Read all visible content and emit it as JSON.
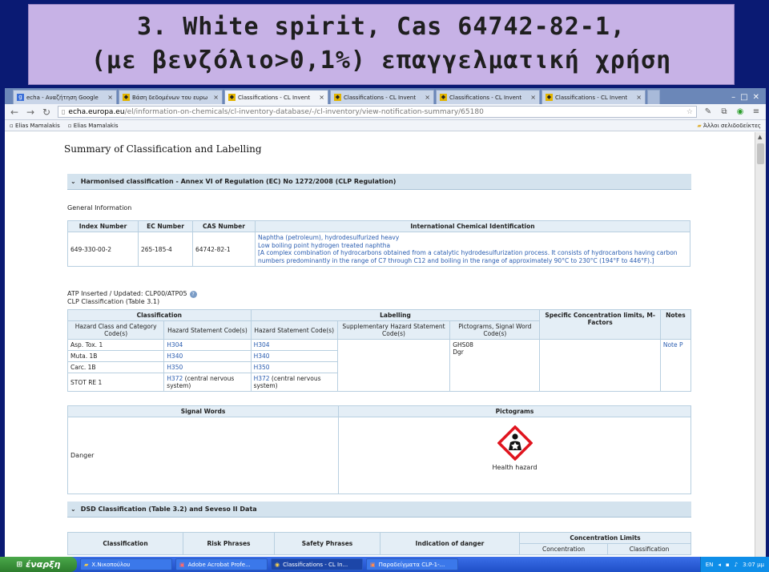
{
  "banner": {
    "line1": "3. White spirit, Cas 64742-82-1,",
    "line2": "(με βενζόλιο>0,1%) επαγγελματική χρήση"
  },
  "browser": {
    "tabs": [
      {
        "label": "echa - Αναζήτηση Google",
        "icon": "google-icon"
      },
      {
        "label": "Βάση δεδομένων του ευρω",
        "icon": "echa-icon"
      },
      {
        "label": "Classifications - CL Invent",
        "icon": "echa-icon",
        "active": true
      },
      {
        "label": "Classifications - CL Invent",
        "icon": "echa-icon"
      },
      {
        "label": "Classifications - CL Invent",
        "icon": "echa-icon"
      },
      {
        "label": "Classifications - CL Invent",
        "icon": "echa-icon"
      }
    ],
    "url_host": "echa.europa.eu",
    "url_path": "/el/information-on-chemicals/cl-inventory-database/-/cl-inventory/view-notification-summary/65180",
    "bookmarks": [
      "Elias Mamalakis",
      "Elias Mamalakis"
    ],
    "other_bookmarks": "Άλλοι σελιδοδείκτες"
  },
  "page": {
    "title": "Summary of Classification and Labelling",
    "harmonised_header": "Harmonised classification - Annex VI of Regulation (EC) No 1272/2008 (CLP Regulation)",
    "general_info": "General Information",
    "ident_headers": [
      "Index Number",
      "EC Number",
      "CAS Number",
      "International Chemical Identification"
    ],
    "ident_row": {
      "index": "649-330-00-2",
      "ec": "265-185-4",
      "cas": "64742-82-1",
      "name_lines": [
        "Naphtha (petroleum), hydrodesulfurized heavy",
        "Low boiling point hydrogen treated naphtha",
        "[A complex combination of hydrocarbons obtained from a catalytic hydrodesulfurization process. It consists of hydrocarbons having carbon numbers predominantly in the range of C7 through C12 and boiling in the range of approximately 90°C to 230°C (194°F to 446°F).]"
      ]
    },
    "atp": "ATP Inserted / Updated: CLP00/ATP05",
    "clp_table": "CLP Classification (Table 3.1)",
    "class_headers": {
      "classification": "Classification",
      "labelling": "Labelling",
      "scl": "Specific Concentration limits, M-Factors",
      "notes": "Notes",
      "hazard_class": "Hazard Class and Category Code(s)",
      "hazard_stmt": "Hazard Statement Code(s)",
      "label_stmt": "Hazard Statement Code(s)",
      "supp_stmt": "Supplementary Hazard Statement Code(s)",
      "pictograms": "Pictograms, Signal Word Code(s)"
    },
    "class_rows": [
      {
        "cls": "Asp. Tox. 1",
        "h": "H304",
        "lh": "H304"
      },
      {
        "cls": "Muta. 1B",
        "h": "H340",
        "lh": "H340"
      },
      {
        "cls": "Carc. 1B",
        "h": "H350",
        "lh": "H350"
      },
      {
        "cls": "STOT RE 1",
        "h": "H372",
        "h_note": " (central nervous system)",
        "lh": "H372",
        "lh_note": " (central nervous system)"
      }
    ],
    "pictogram_codes": [
      "GHS08",
      "Dgr"
    ],
    "notes_link": "Note P",
    "signal_header": "Signal Words",
    "pictograms_header": "Pictograms",
    "signal_word": "Danger",
    "pictogram_caption": "Health hazard",
    "dsd_header": "DSD Classification (Table 3.2) and Seveso II Data",
    "dsd_headers": {
      "classification": "Classification",
      "risk": "Risk Phrases",
      "safety": "Safety Phrases",
      "indication": "Indication of danger",
      "conc_limits": "Concentration Limits",
      "concentration": "Concentration",
      "conc_class": "Classification"
    }
  },
  "taskbar": {
    "start": "έναρξη",
    "tasks": [
      {
        "label": "X.Νικοπούλου",
        "icon": "folder-icon"
      },
      {
        "label": "Adobe Acrobat Profe...",
        "icon": "acrobat-icon"
      },
      {
        "label": "Classifications - CL In...",
        "icon": "chrome-icon",
        "active": true
      },
      {
        "label": "Παραδείγματα CLP-1-...",
        "icon": "powerpoint-icon"
      }
    ],
    "lang": "EN",
    "time": "3:07 μμ"
  }
}
